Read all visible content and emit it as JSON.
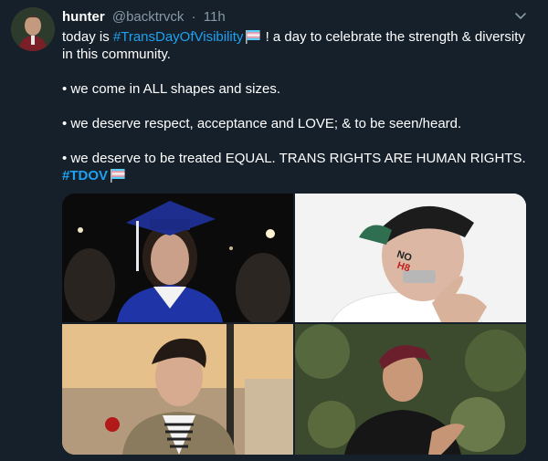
{
  "tweet": {
    "display_name": "hunter",
    "handle": "@backtrvck",
    "separator": "·",
    "time": "11h",
    "paragraph1_lead": "today is ",
    "paragraph1_hashtag": "#TransDayOfVisibility",
    "paragraph1_trail": " ! a day to celebrate the strength & diversity in this community.",
    "bullet1": "• we come in ALL shapes and sizes.",
    "bullet2": "• we deserve respect, acceptance and  LOVE; & to be seen/heard.",
    "bullet3": "• we deserve to be treated EQUAL. TRANS RIGHTS ARE HUMAN RIGHTS.",
    "closing_hashtag": "#TDOV"
  },
  "icons": {
    "chevron": "chevron-down-icon",
    "flag": "transgender-flag-emoji"
  },
  "photo_text": {
    "cheek_text": "NO H8"
  },
  "colors": {
    "background": "#15202b",
    "text": "#ffffff",
    "secondary_text": "#8899a6",
    "link": "#1da1f2",
    "flag_blue": "#5bcefa",
    "flag_pink": "#f5a9b8"
  }
}
